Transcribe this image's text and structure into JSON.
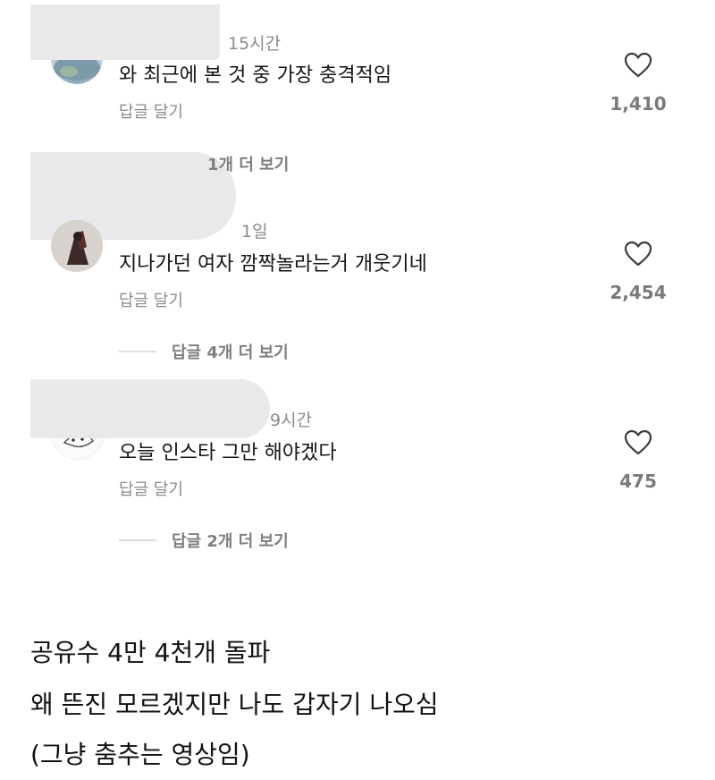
{
  "comments": [
    {
      "time": "15시간",
      "text": "와 최근에 본 것 중 가장 충격적임",
      "reply_label": "답글 달기",
      "likes": "1,410",
      "more_replies": "1개 더 보기"
    },
    {
      "time": "1일",
      "text": "지나가던 여자 깜짝놀라는거 개웃기네",
      "reply_label": "답글 달기",
      "likes": "2,454",
      "more_replies": "답글 4개 더 보기"
    },
    {
      "time": "9시간",
      "text": "오늘 인스타 그만 해야겠다",
      "reply_label": "답글 달기",
      "likes": "475",
      "more_replies": "답글 2개 더 보기"
    }
  ],
  "caption": {
    "line1": "공유수 4만 4천개 돌파",
    "line2": "왜 뜬진 모르겠지만 나도 갑자기 나오심",
    "line3": "(그냥 춤추는 영상임)"
  },
  "icons": {
    "like": "heart-outline-icon"
  },
  "colors": {
    "redaction": "#e9e9ec",
    "secondary_text": "#8b8b8b"
  }
}
